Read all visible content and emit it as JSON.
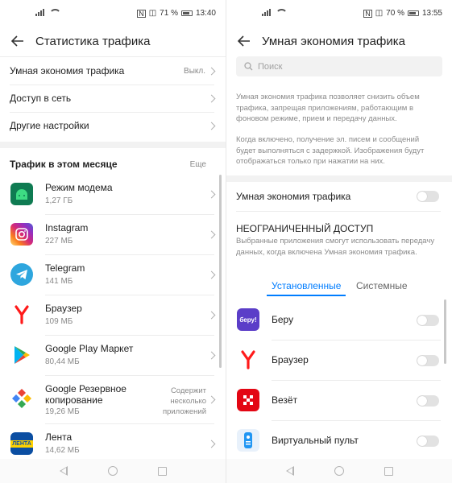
{
  "left": {
    "status": {
      "battery_pct": "71 %",
      "time": "13:40"
    },
    "title": "Статистика трафика",
    "menu": [
      {
        "label": "Умная экономия трафика",
        "value": "Выкл."
      },
      {
        "label": "Доступ в сеть"
      },
      {
        "label": "Другие настройки"
      }
    ],
    "section_title": "Трафик в этом месяце",
    "more_label": "Еще",
    "apps": [
      {
        "name": "Режим модема",
        "size": "1,27 ГБ",
        "icon": "android-icon",
        "color": "#3ddc84"
      },
      {
        "name": "Instagram",
        "size": "227 МБ",
        "icon": "instagram-icon",
        "color": "#d62976"
      },
      {
        "name": "Telegram",
        "size": "141 МБ",
        "icon": "telegram-icon",
        "color": "#2ea6de"
      },
      {
        "name": "Браузер",
        "size": "109 МБ",
        "icon": "yandex-browser-icon",
        "color": "#ff0000"
      },
      {
        "name": "Google Play Маркет",
        "size": "80,44 МБ",
        "icon": "google-play-icon",
        "color": "#01875f"
      },
      {
        "name": "Google Резервное копирование",
        "size": "19,26 МБ",
        "icon": "google-backup-icon",
        "color": "#4285f4",
        "note": "Содержит несколько приложений"
      },
      {
        "name": "Лента",
        "size": "14,62 МБ",
        "icon": "lenta-icon",
        "color": "#0b4ea2"
      }
    ]
  },
  "right": {
    "status": {
      "battery_pct": "70 %",
      "time": "13:55"
    },
    "title": "Умная экономия трафика",
    "search_placeholder": "Поиск",
    "desc1": "Умная экономия трафика позволяет снизить объем трафика, запрещая приложениям, работающим в фоновом режиме, прием и передачу данных.",
    "desc2": "Когда включено, получение эл. писем и сообщений будет выполняться с задержкой. Изображения будут отображаться только при нажатии на них.",
    "toggle_label": "Умная экономия трафика",
    "unlimited_title": "НЕОГРАНИЧЕННЫЙ ДОСТУП",
    "unlimited_desc": "Выбранные приложения смогут использовать передачу данных, когда включена Умная экономия трафика.",
    "tabs": [
      "Установленные",
      "Системные"
    ],
    "apps": [
      {
        "name": "Беру",
        "icon": "beru-icon",
        "color": "#5b3ec8",
        "icon_text": "беру!"
      },
      {
        "name": "Браузер",
        "icon": "yandex-browser-icon",
        "color": "#ff0000",
        "icon_text": ""
      },
      {
        "name": "Везёт",
        "icon": "vezet-icon",
        "color": "#e30613",
        "icon_text": ""
      },
      {
        "name": "Виртуальный пульт",
        "icon": "remote-icon",
        "color": "#2196f3",
        "icon_text": ""
      }
    ]
  }
}
